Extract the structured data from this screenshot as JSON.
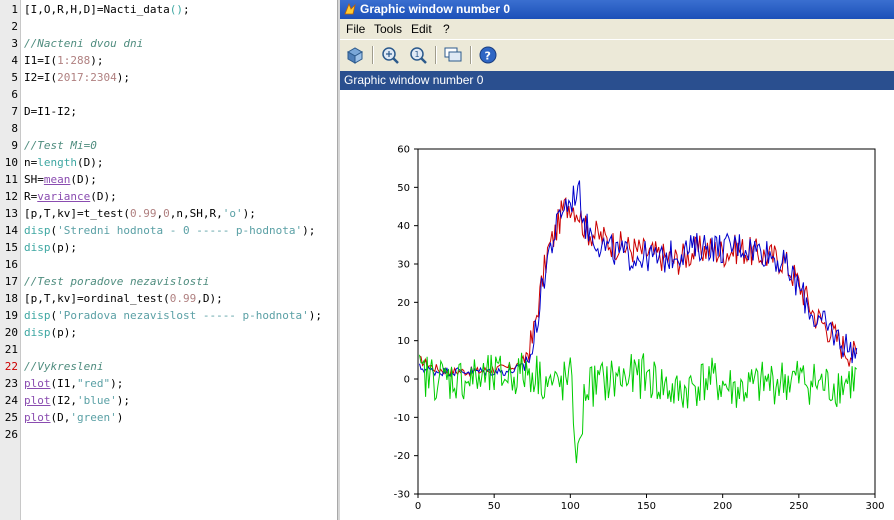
{
  "editor": {
    "current_line": 22,
    "lines": [
      {
        "n": "1",
        "tokens": [
          {
            "c": "k-op",
            "t": "[I,O,R,H,D]=Nacti_data"
          },
          {
            "c": "k-fn",
            "t": "()"
          },
          {
            "c": "k-op",
            "t": ";"
          }
        ]
      },
      {
        "n": "2",
        "tokens": []
      },
      {
        "n": "3",
        "tokens": [
          {
            "c": "k-com",
            "t": "//Nacteni dvou dni"
          }
        ]
      },
      {
        "n": "4",
        "tokens": [
          {
            "c": "k-op",
            "t": "I1=I("
          },
          {
            "c": "k-num",
            "t": "1:288"
          },
          {
            "c": "k-op",
            "t": ");"
          }
        ]
      },
      {
        "n": "5",
        "tokens": [
          {
            "c": "k-op",
            "t": "I2=I("
          },
          {
            "c": "k-num",
            "t": "2017:2304"
          },
          {
            "c": "k-op",
            "t": ");"
          }
        ]
      },
      {
        "n": "6",
        "tokens": []
      },
      {
        "n": "7",
        "tokens": [
          {
            "c": "k-op",
            "t": "D=I1-I2;"
          }
        ]
      },
      {
        "n": "8",
        "tokens": []
      },
      {
        "n": "9",
        "tokens": [
          {
            "c": "k-com",
            "t": "//Test Mi=0"
          }
        ]
      },
      {
        "n": "10",
        "tokens": [
          {
            "c": "k-op",
            "t": "n="
          },
          {
            "c": "k-fn",
            "t": "length"
          },
          {
            "c": "k-op",
            "t": "(D);"
          }
        ]
      },
      {
        "n": "11",
        "tokens": [
          {
            "c": "k-op",
            "t": "SH="
          },
          {
            "c": "k-mac",
            "t": "mean"
          },
          {
            "c": "k-op",
            "t": "(D);"
          }
        ]
      },
      {
        "n": "12",
        "tokens": [
          {
            "c": "k-op",
            "t": "R="
          },
          {
            "c": "k-mac",
            "t": "variance"
          },
          {
            "c": "k-op",
            "t": "(D);"
          }
        ]
      },
      {
        "n": "13",
        "tokens": [
          {
            "c": "k-op",
            "t": "[p,T,kv]=t_test("
          },
          {
            "c": "k-num",
            "t": "0.99"
          },
          {
            "c": "k-op",
            "t": ","
          },
          {
            "c": "k-num",
            "t": "0"
          },
          {
            "c": "k-op",
            "t": ",n,SH,R,"
          },
          {
            "c": "k-str",
            "t": "'o'"
          },
          {
            "c": "k-op",
            "t": ");"
          }
        ]
      },
      {
        "n": "14",
        "tokens": [
          {
            "c": "k-fn",
            "t": "disp"
          },
          {
            "c": "k-op",
            "t": "("
          },
          {
            "c": "k-str",
            "t": "'Stredni hodnota - 0 ----- p-hodnota'"
          },
          {
            "c": "k-op",
            "t": ");"
          }
        ]
      },
      {
        "n": "15",
        "tokens": [
          {
            "c": "k-fn",
            "t": "disp"
          },
          {
            "c": "k-op",
            "t": "(p);"
          }
        ]
      },
      {
        "n": "16",
        "tokens": []
      },
      {
        "n": "17",
        "tokens": [
          {
            "c": "k-com",
            "t": "//Test poradove nezavislosti"
          }
        ]
      },
      {
        "n": "18",
        "tokens": [
          {
            "c": "k-op",
            "t": "[p,T,kv]=ordinal_test("
          },
          {
            "c": "k-num",
            "t": "0.99"
          },
          {
            "c": "k-op",
            "t": ",D);"
          }
        ]
      },
      {
        "n": "19",
        "tokens": [
          {
            "c": "k-fn",
            "t": "disp"
          },
          {
            "c": "k-op",
            "t": "("
          },
          {
            "c": "k-str",
            "t": "'Poradova nezavislost ----- p-hodnota'"
          },
          {
            "c": "k-op",
            "t": ");"
          }
        ]
      },
      {
        "n": "20",
        "tokens": [
          {
            "c": "k-fn",
            "t": "disp"
          },
          {
            "c": "k-op",
            "t": "(p);"
          }
        ]
      },
      {
        "n": "21",
        "tokens": []
      },
      {
        "n": "22",
        "tokens": [
          {
            "c": "k-com",
            "t": "//Vykresleni"
          }
        ]
      },
      {
        "n": "23",
        "tokens": [
          {
            "c": "k-mac",
            "t": "plot"
          },
          {
            "c": "k-op",
            "t": "(I1,"
          },
          {
            "c": "k-str",
            "t": "\"red\""
          },
          {
            "c": "k-op",
            "t": ");"
          }
        ]
      },
      {
        "n": "24",
        "tokens": [
          {
            "c": "k-mac",
            "t": "plot"
          },
          {
            "c": "k-op",
            "t": "(I2,"
          },
          {
            "c": "k-str",
            "t": "'blue'"
          },
          {
            "c": "k-op",
            "t": ");"
          }
        ]
      },
      {
        "n": "25",
        "tokens": [
          {
            "c": "k-mac",
            "t": "plot"
          },
          {
            "c": "k-op",
            "t": "(D,"
          },
          {
            "c": "k-str",
            "t": "'green'"
          },
          {
            "c": "k-op",
            "t": ")"
          }
        ]
      },
      {
        "n": "26",
        "tokens": []
      }
    ]
  },
  "graphic_window": {
    "title": "Graphic window number 0",
    "tab_title": "Graphic window number 0",
    "menu": [
      "File",
      "Tools",
      "Edit",
      "?"
    ],
    "toolbar_icons": [
      "rotate-icon",
      "zoom-icon",
      "unzoom-icon",
      "datatip-icon",
      "help-icon"
    ]
  },
  "chart_data": {
    "type": "line",
    "xlim": [
      0,
      300
    ],
    "ylim": [
      -30,
      60
    ],
    "xticks": [
      0,
      50,
      100,
      150,
      200,
      250,
      300
    ],
    "yticks": [
      -30,
      -20,
      -10,
      0,
      10,
      20,
      30,
      40,
      50,
      60
    ],
    "grid": false,
    "n_points": 288,
    "series": [
      {
        "color": "#cc0000",
        "label_note": "I1",
        "anchors": [
          [
            1,
            5
          ],
          [
            10,
            3
          ],
          [
            20,
            2
          ],
          [
            40,
            2
          ],
          [
            60,
            3
          ],
          [
            68,
            4
          ],
          [
            75,
            10
          ],
          [
            80,
            22
          ],
          [
            85,
            33
          ],
          [
            90,
            38
          ],
          [
            95,
            44
          ],
          [
            100,
            46
          ],
          [
            105,
            44
          ],
          [
            110,
            39
          ],
          [
            120,
            37
          ],
          [
            130,
            35
          ],
          [
            140,
            34
          ],
          [
            150,
            33
          ],
          [
            160,
            32
          ],
          [
            170,
            31
          ],
          [
            180,
            33
          ],
          [
            190,
            34
          ],
          [
            200,
            33
          ],
          [
            210,
            34
          ],
          [
            220,
            33
          ],
          [
            230,
            32
          ],
          [
            240,
            31
          ],
          [
            250,
            25
          ],
          [
            260,
            17
          ],
          [
            270,
            13
          ],
          [
            280,
            8
          ],
          [
            288,
            6
          ]
        ]
      },
      {
        "color": "#0000cc",
        "label_note": "I2",
        "anchors": [
          [
            1,
            3
          ],
          [
            10,
            2
          ],
          [
            20,
            2
          ],
          [
            40,
            2
          ],
          [
            60,
            2
          ],
          [
            68,
            3
          ],
          [
            75,
            7
          ],
          [
            80,
            20
          ],
          [
            85,
            32
          ],
          [
            90,
            38
          ],
          [
            95,
            45
          ],
          [
            100,
            46
          ],
          [
            105,
            50
          ],
          [
            110,
            40
          ],
          [
            120,
            35
          ],
          [
            130,
            33
          ],
          [
            140,
            32
          ],
          [
            150,
            32
          ],
          [
            160,
            31
          ],
          [
            170,
            33
          ],
          [
            180,
            34
          ],
          [
            190,
            35
          ],
          [
            200,
            34
          ],
          [
            210,
            35
          ],
          [
            220,
            34
          ],
          [
            230,
            33
          ],
          [
            240,
            30
          ],
          [
            250,
            24
          ],
          [
            260,
            16
          ],
          [
            270,
            13
          ],
          [
            280,
            9
          ],
          [
            288,
            7
          ]
        ]
      },
      {
        "color": "#00cc00",
        "label_note": "D",
        "anchors": [
          [
            1,
            1
          ],
          [
            20,
            0
          ],
          [
            40,
            0
          ],
          [
            60,
            1
          ],
          [
            75,
            2
          ],
          [
            90,
            -2
          ],
          [
            100,
            0
          ],
          [
            105,
            -22
          ],
          [
            110,
            -2
          ],
          [
            130,
            0
          ],
          [
            150,
            1
          ],
          [
            170,
            -4
          ],
          [
            190,
            0
          ],
          [
            210,
            -3
          ],
          [
            230,
            -1
          ],
          [
            250,
            0
          ],
          [
            270,
            -2
          ],
          [
            288,
            0
          ]
        ]
      }
    ]
  }
}
